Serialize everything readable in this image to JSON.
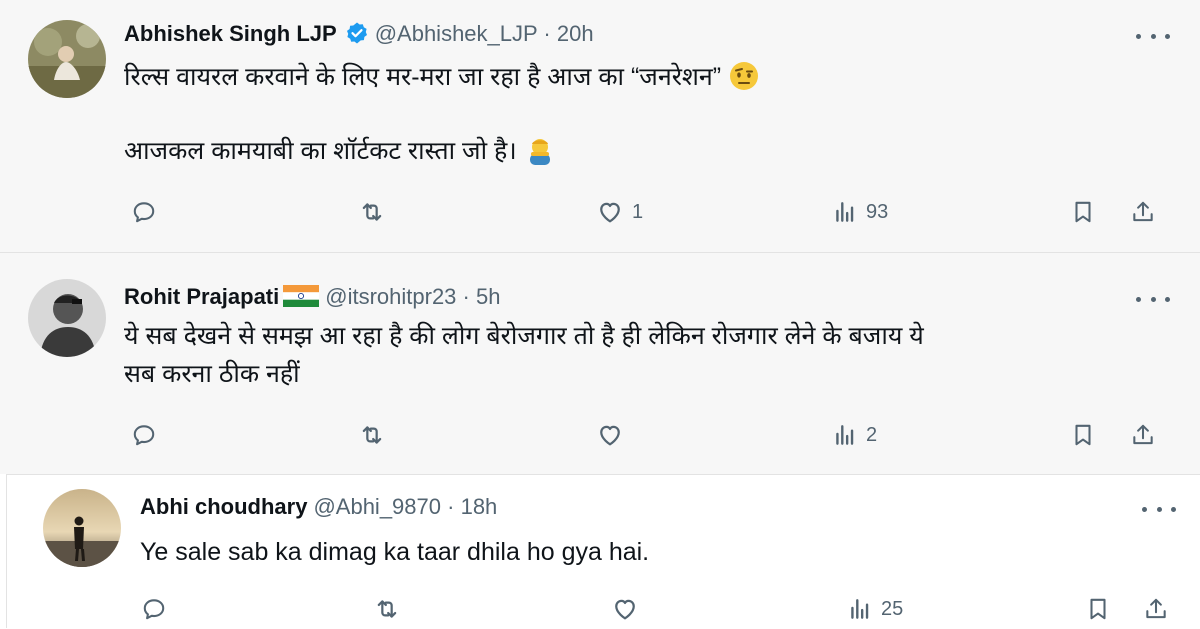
{
  "tweets": [
    {
      "name": "Abhishek Singh LJP",
      "handle": "@Abhishek_LJP",
      "separator": "·",
      "time": "20h",
      "verified": true,
      "text_line1": "रिल्स वायरल करवाने के लिए मर-मरा जा रहा है आज का “जनरेशन”",
      "text_line2": "आजकल कामयाबी का शॉर्टकट रास्ता जो है।",
      "emoji1": "face-with-raised-eyebrow",
      "emoji2": "person-facepalm",
      "reply_count": "",
      "retweet_count": "",
      "like_count": "1",
      "view_count": "93"
    },
    {
      "name": "Rohit Prajapati",
      "handle": "@itsrohitpr23",
      "separator": "·",
      "time": "5h",
      "flag": "india-flag",
      "text_line1": "ये सब देखने से समझ आ रहा है की लोग बेरोजगार तो है ही लेकिन रोजगार लेने के बजाय ये",
      "text_line2": "सब करना ठीक नहीं",
      "reply_count": "",
      "retweet_count": "",
      "like_count": "",
      "view_count": "2"
    },
    {
      "name": "Abhi choudhary",
      "handle": "@Abhi_9870",
      "separator": "·",
      "time": "18h",
      "text_line1": "Ye sale sab ka dimag ka taar dhila ho gya hai.",
      "reply_count": "",
      "retweet_count": "",
      "like_count": "",
      "view_count": "25"
    }
  ],
  "colors": {
    "text": "#0f1419",
    "muted": "#536471",
    "verified": "#1d9bf0",
    "bg_highlight": "#f7f7f7"
  },
  "icons": [
    "reply-icon",
    "retweet-icon",
    "like-icon",
    "views-icon",
    "bookmark-icon",
    "share-icon",
    "more-icon",
    "verified-badge-icon"
  ]
}
